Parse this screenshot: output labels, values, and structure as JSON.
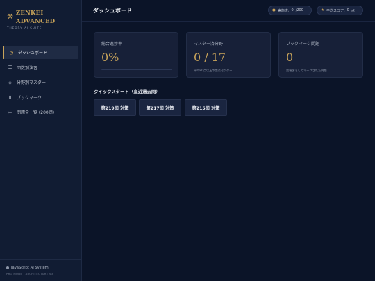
{
  "brand": {
    "icon": "pickaxe-icon",
    "title": "ZENKEI ADVANCED",
    "subtitle": "THEORY AI SUITE",
    "accent_color": "#c9a45a"
  },
  "sidebar": {
    "items": [
      {
        "label": "ダッシュボード",
        "icon": "pie-chart-icon",
        "active": true
      },
      {
        "label": "回数別演習",
        "icon": "stack-icon",
        "active": false
      },
      {
        "label": "分野別マスター",
        "icon": "tag-icon",
        "active": false
      },
      {
        "label": "ブックマーク",
        "icon": "bookmark-icon",
        "active": false
      },
      {
        "label": "問題全一覧 (200問)",
        "icon": "list-icon",
        "active": false
      }
    ],
    "footer": {
      "system": "JavaScript AI System",
      "mode": "PRO MODE · ARCHITECTURE V3"
    }
  },
  "header": {
    "title": "ダッシュボード",
    "answered": {
      "label": "実施済:",
      "value": "0",
      "total": "/200"
    },
    "avg_score": {
      "label": "平均スコア:",
      "value": "0",
      "unit": "点"
    }
  },
  "cards": [
    {
      "label": "総合進捗率",
      "value": "0%",
      "progress": 0
    },
    {
      "label": "マスター済分野",
      "value": "0 / 17",
      "note": "平均80点以上の論点セクター"
    },
    {
      "label": "ブックマーク問題",
      "value": "0",
      "note": "要復習としてマークされた問題"
    }
  ],
  "quick_start": {
    "title": "クイックスタート（直近過去問）",
    "buttons": [
      "第219回 対策",
      "第217回 対策",
      "第215回 対策"
    ]
  }
}
